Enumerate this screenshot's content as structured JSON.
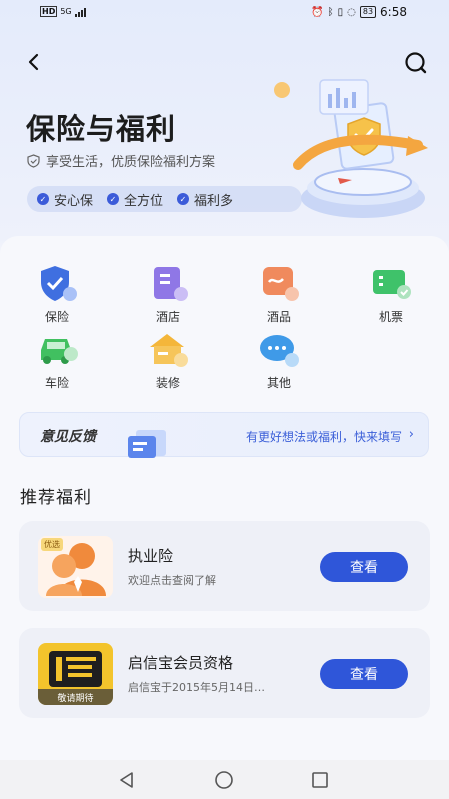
{
  "status_bar": {
    "network": "HD",
    "signal": "5G",
    "battery": "83",
    "time": "6:58",
    "icons": [
      "alarm-icon",
      "bluetooth-icon",
      "vibrate-icon",
      "nfc-icon",
      "battery-icon"
    ]
  },
  "header": {
    "title": "保险与福利",
    "subtitle": "享受生活，优质保险福利方案",
    "tags": [
      "安心保",
      "全方位",
      "福利多"
    ]
  },
  "categories": [
    {
      "label": "保险",
      "icon": "shield-icon",
      "color": "#3f6fe0"
    },
    {
      "label": "酒店",
      "icon": "hotel-icon",
      "color": "#8f77e6"
    },
    {
      "label": "酒品",
      "icon": "wine-icon",
      "color": "#f08a5d"
    },
    {
      "label": "机票",
      "icon": "ticket-icon",
      "color": "#3fc26a"
    },
    {
      "label": "车险",
      "icon": "car-icon",
      "color": "#41c060"
    },
    {
      "label": "装修",
      "icon": "house-icon",
      "color": "#f4b63a"
    },
    {
      "label": "其他",
      "icon": "chat-bubble-icon",
      "color": "#3f9ae8"
    }
  ],
  "feedback": {
    "title": "意见反馈",
    "link_text": "有更好想法或福利，快来填写"
  },
  "recommend": {
    "section_title": "推荐福利",
    "items": [
      {
        "name": "执业险",
        "desc": "欢迎点击查阅了解",
        "button": "查看",
        "badge": "优选"
      },
      {
        "name": "启信宝会员资格",
        "desc": "启信宝于2015年5月14日…",
        "button": "查看",
        "badge": "敬请期待"
      }
    ]
  },
  "colors": {
    "accent": "#2f56d9",
    "background": "#f7f8fc"
  }
}
